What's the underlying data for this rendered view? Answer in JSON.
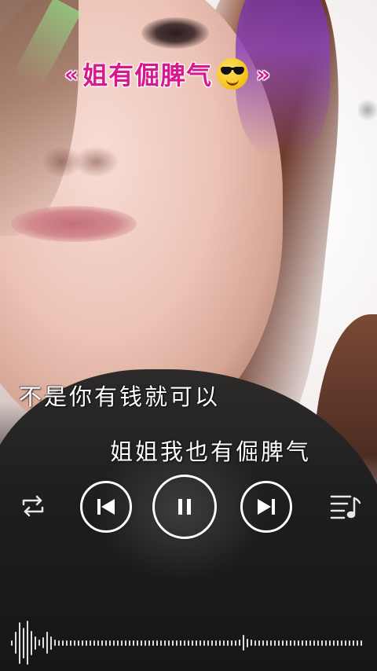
{
  "overlay_title": {
    "open_quote": "«",
    "text": "姐有倔脾气",
    "close_quote": "»",
    "emoji": "sunglasses-emoji",
    "color": "#d8198e"
  },
  "lyrics": {
    "line1": "不是你有钱就可以",
    "line2": "姐姐我也有倔脾气"
  },
  "player": {
    "controls": [
      "repeat-icon",
      "previous-icon",
      "pause-icon",
      "next-icon",
      "playlist-icon"
    ],
    "state": "playing"
  },
  "waveform": {
    "levels": [
      0.12,
      0.5,
      0.95,
      0.7,
      1.0,
      0.55,
      0.3,
      0.15,
      0.25,
      0.5,
      0.3,
      0.15,
      0.12,
      0.12,
      0.12,
      0.12,
      0.12,
      0.12,
      0.12,
      0.12,
      0.12,
      0.12,
      0.12,
      0.12,
      0.12,
      0.12,
      0.12,
      0.12,
      0.12,
      0.12,
      0.12,
      0.12,
      0.12,
      0.12,
      0.12,
      0.12,
      0.12,
      0.12,
      0.12,
      0.12,
      0.12,
      0.12,
      0.12,
      0.12,
      0.12,
      0.12,
      0.12,
      0.12,
      0.12,
      0.12,
      0.12,
      0.12,
      0.12,
      0.12,
      0.12,
      0.12,
      0.12,
      0.12,
      0.15,
      0.35,
      0.2,
      0.15,
      0.12,
      0.12,
      0.12,
      0.12,
      0.12,
      0.12,
      0.12,
      0.12,
      0.12,
      0.12,
      0.12,
      0.12,
      0.12,
      0.12,
      0.12,
      0.12,
      0.12,
      0.12,
      0.12,
      0.12,
      0.12,
      0.12,
      0.12,
      0.12,
      0.12,
      0.12,
      0.12,
      0.12
    ]
  }
}
